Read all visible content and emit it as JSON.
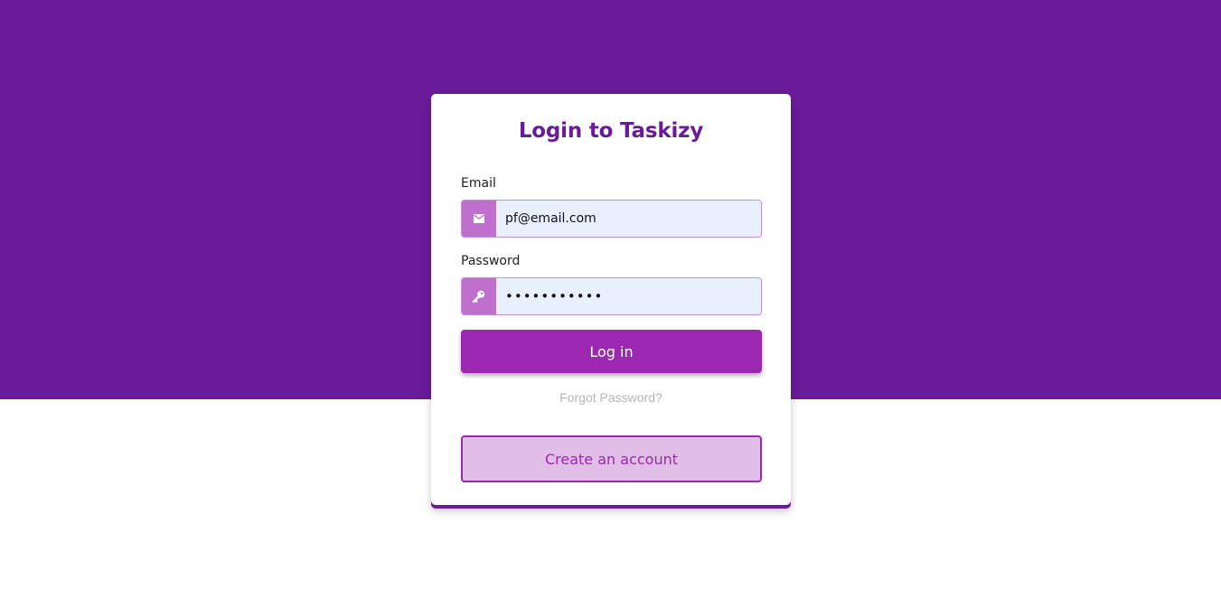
{
  "login_form": {
    "title": "Login to Taskizy",
    "email": {
      "label": "Email",
      "value": "pf@email.com",
      "icon": "envelope-icon"
    },
    "password": {
      "label": "Password",
      "value": "•••••••••••",
      "icon": "key-icon"
    },
    "login_button_label": "Log in",
    "forgot_password_label": "Forgot Password?",
    "create_account_label": "Create an account"
  },
  "colors": {
    "brand_purple_dark": "#6a1b9a",
    "brand_purple": "#9c27b0",
    "icon_addon": "#bf6fcc",
    "create_account_bg": "#e1bee7",
    "input_bg": "#e8f0fe",
    "forgot_link": "#b5b5b5"
  }
}
